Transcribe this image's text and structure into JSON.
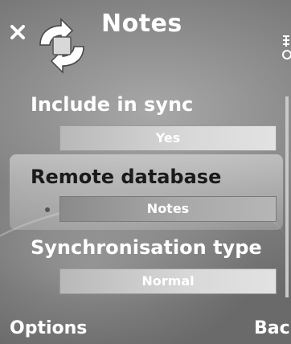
{
  "titlebar": {
    "title": "Notes",
    "close_icon": "close-icon",
    "app_icon": "sync-arrows-icon"
  },
  "settings": [
    {
      "label": "Include in sync",
      "value": "Yes",
      "highlighted": false
    },
    {
      "label": "Remote database",
      "value": "Notes",
      "highlighted": true
    },
    {
      "label": "Synchronisation type",
      "value": "Normal",
      "highlighted": false
    }
  ],
  "softkeys": {
    "left": "Options",
    "right": "Back"
  },
  "colors": {
    "text": "#ffffff",
    "highlight_text": "#1a1a1a",
    "background": "#8f8f8f"
  }
}
